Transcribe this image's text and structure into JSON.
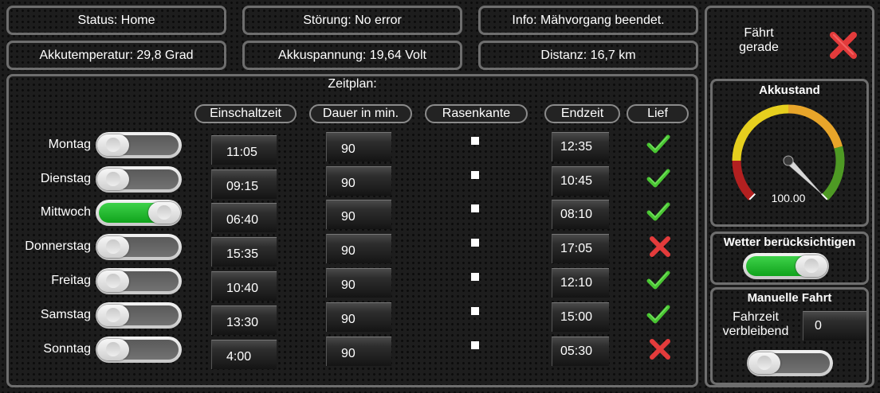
{
  "status_bar": {
    "status": "Status: Home",
    "stoerung": "Störung: No error",
    "info": "Info: Mähvorgang beendet.",
    "akkutemperatur": "Akkutemperatur: 29,8 Grad",
    "akkuspannung": "Akkuspannung: 19,64 Volt",
    "distanz": "Distanz: 16,7 km"
  },
  "schedule": {
    "title": "Zeitplan:",
    "headers": {
      "einschaltzeit": "Einschaltzeit",
      "dauer": "Dauer in min.",
      "rasenkante": "Rasenkante",
      "endzeit": "Endzeit",
      "lief": "Lief"
    },
    "rows": [
      {
        "day": "Montag",
        "enabled": false,
        "start": "11:05",
        "duration": "90",
        "edge": false,
        "end": "12:35",
        "ran": true
      },
      {
        "day": "Dienstag",
        "enabled": false,
        "start": "09:15",
        "duration": "90",
        "edge": false,
        "end": "10:45",
        "ran": true
      },
      {
        "day": "Mittwoch",
        "enabled": true,
        "start": "06:40",
        "duration": "90",
        "edge": false,
        "end": "08:10",
        "ran": true
      },
      {
        "day": "Donnerstag",
        "enabled": false,
        "start": "15:35",
        "duration": "90",
        "edge": false,
        "end": "17:05",
        "ran": false
      },
      {
        "day": "Freitag",
        "enabled": false,
        "start": "10:40",
        "duration": "90",
        "edge": false,
        "end": "12:10",
        "ran": true
      },
      {
        "day": "Samstag",
        "enabled": false,
        "start": "13:30",
        "duration": "90",
        "edge": false,
        "end": "15:00",
        "ran": true
      },
      {
        "day": "Sonntag",
        "enabled": false,
        "start": "4:00",
        "duration": "90",
        "edge": false,
        "end": "05:30",
        "ran": false
      }
    ]
  },
  "drive": {
    "label": "Fährt gerade",
    "active": false
  },
  "battery": {
    "title": "Akkustand",
    "value": 100,
    "value_text": "100.00",
    "max": 100,
    "colors": {
      "low": "#b32020",
      "mid": "#e6cf1e",
      "high": "#e8a52a",
      "full": "#4e9a24"
    }
  },
  "weather": {
    "title": "Wetter berücksichtigen",
    "enabled": true
  },
  "manual": {
    "title": "Manuelle Fahrt",
    "remaining_label_1": "Fahrzeit",
    "remaining_label_2": "verbleibend",
    "remaining_value": "0",
    "enabled": false
  },
  "icons": {
    "ran_yes": "check-icon",
    "ran_no": "cross-icon",
    "check_color": "#49c632",
    "cross_color": "#e33b3b"
  }
}
